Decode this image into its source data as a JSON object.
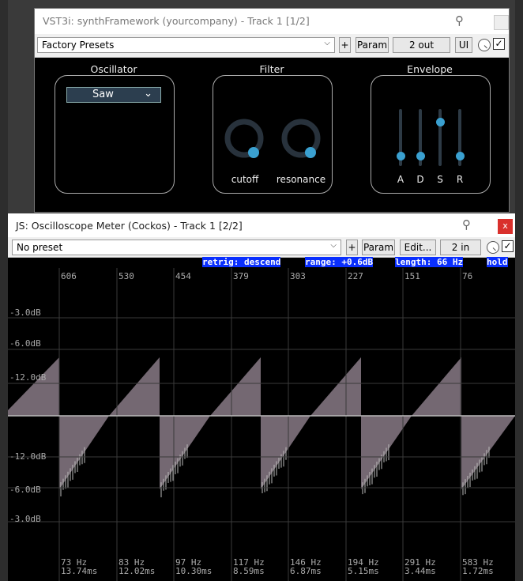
{
  "window1": {
    "title": "VST3i: synthFramework (yourcompany) - Track 1 [1/2]",
    "preset": "Factory Presets",
    "plus_label": "+",
    "param_label": "Param",
    "io_label": "2 out",
    "ui_label": "UI",
    "check": "✓",
    "oscillator_label": "Oscillator",
    "wave_value": "Saw",
    "filter_label": "Filter",
    "cutoff_label": "cutoff",
    "resonance_label": "resonance",
    "envelope_label": "Envelope",
    "env_labels": [
      "A",
      "D",
      "S",
      "R"
    ],
    "env_levels": [
      0.1,
      0.1,
      0.85,
      0.1
    ],
    "cutoff_level": 1.0,
    "resonance_level": 1.0
  },
  "window2": {
    "title": "JS: Oscilloscope Meter (Cockos) - Track 1 [2/2]",
    "close_label": "x",
    "preset": "No preset",
    "plus_label": "+",
    "param_label": "Param",
    "edit_label": "Edit...",
    "io_label": "2 in",
    "check": "✓",
    "status": [
      "retrig: descend",
      "range: +0.6dB",
      "length: 66 Hz",
      "hold"
    ],
    "top_ticks": [
      "606",
      "530",
      "454",
      "379",
      "303",
      "227",
      "151",
      "76"
    ],
    "db_labels_top": [
      "-3.0dB",
      "-6.0dB",
      "-12.0dB"
    ],
    "db_labels_bottom": [
      "-12.0dB",
      "-6.0dB",
      "-3.0dB"
    ],
    "freq_labels": [
      "73 Hz",
      "83 Hz",
      "97 Hz",
      "117 Hz",
      "146 Hz",
      "194 Hz",
      "291 Hz",
      "583 Hz"
    ],
    "time_labels": [
      "13.74ms",
      "12.02ms",
      "10.30ms",
      "8.59ms",
      "6.87ms",
      "5.15ms",
      "3.44ms",
      "1.72ms"
    ]
  },
  "colors": {
    "accent": "#3aa0d0",
    "scope_fill": "#7a6e78",
    "status_bg": "#0a2fff"
  }
}
